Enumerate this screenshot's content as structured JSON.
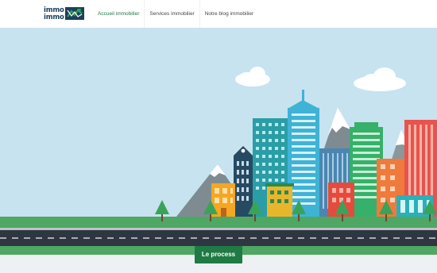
{
  "logo": {
    "line1": "immo",
    "line2": "immo",
    "alt": "immo immo logo"
  },
  "nav": {
    "items": [
      {
        "label": "Accueil immobilier",
        "active": true
      },
      {
        "label": "Services immobilier",
        "active": false
      },
      {
        "label": "Notre blog immobilier",
        "active": false
      }
    ]
  },
  "hero": {
    "cta_label": "Le process"
  },
  "colors": {
    "brand_green": "#1f7a43",
    "logo_navy": "#1c3f5c",
    "sky": "#c6e3ef",
    "grass": "#4ea762",
    "road": "#2e3741"
  }
}
